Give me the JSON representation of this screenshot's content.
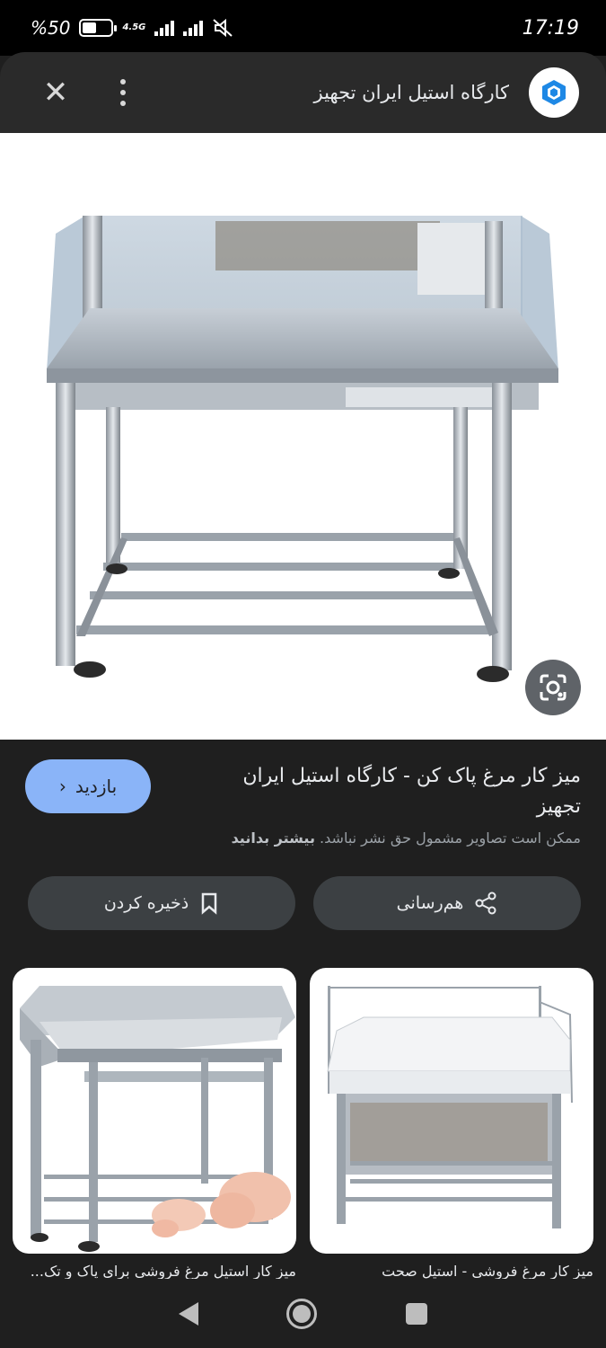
{
  "status_bar": {
    "battery": "%50",
    "battery_level": 0.5,
    "network": "4.5G",
    "time": "17:19"
  },
  "header": {
    "site_name": "کارگاه استیل ایران تجهیز"
  },
  "image": {
    "title": "میز کار مرغ پاک کن - کارگاه استیل ایران تجهیز",
    "copyright_notice": "ممکن است تصاویر مشمول حق نشر نباشد.",
    "learn_more": "بیشتر بدانید"
  },
  "actions": {
    "visit_label": "بازدید",
    "share_label": "هم‌رسانی",
    "save_label": "ذخیره کردن"
  },
  "related": [
    {
      "caption": "میز کار مرغ فروشی - استیل صحت"
    },
    {
      "caption": "میز کار استیل مرغ فروشی برای پاک و تک..."
    }
  ],
  "colors": {
    "accent": "#8ab4f8",
    "background": "#1f1f1f",
    "header": "#2a2a2a",
    "chip": "#3c4043"
  }
}
